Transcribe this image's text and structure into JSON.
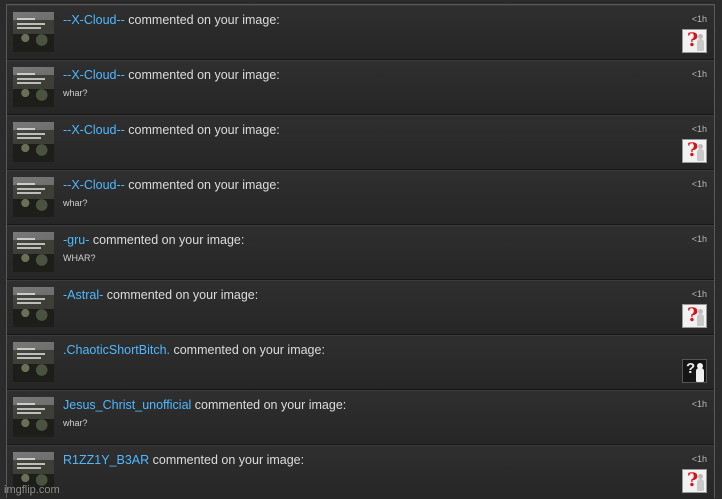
{
  "notifications": [
    {
      "user": "--X-Cloud--",
      "action": " commented on your image:",
      "message": "",
      "time": "<1h",
      "preview": "question-mark-image"
    },
    {
      "user": "--X-Cloud--",
      "action": " commented on your image:",
      "message": "whar?",
      "time": "<1h",
      "preview": ""
    },
    {
      "user": "--X-Cloud--",
      "action": " commented on your image:",
      "message": "",
      "time": "<1h",
      "preview": "question-mark-image"
    },
    {
      "user": "--X-Cloud--",
      "action": " commented on your image:",
      "message": "whar?",
      "time": "<1h",
      "preview": ""
    },
    {
      "user": "-gru-",
      "action": " commented on your image:",
      "message": "WHAR?",
      "time": "<1h",
      "preview": ""
    },
    {
      "user": "-Astral-",
      "action": " commented on your image:",
      "message": "",
      "time": "<1h",
      "preview": "question-mark-image"
    },
    {
      "user": ".ChaoticShortBitch.",
      "action": " commented on your image:",
      "message": "",
      "time": "",
      "preview": "dark-question-mark-image"
    },
    {
      "user": "Jesus_Christ_unofficial",
      "action": " commented on your image:",
      "message": "whar?",
      "time": "<1h",
      "preview": ""
    },
    {
      "user": "R1ZZ1Y_B3AR",
      "action": " commented on your image:",
      "message": "",
      "time": "<1h",
      "preview": "question-mark-image"
    }
  ],
  "watermark": "imgflip.com",
  "colors": {
    "username": "#4fb8ff",
    "background": "#2b2b2b"
  }
}
